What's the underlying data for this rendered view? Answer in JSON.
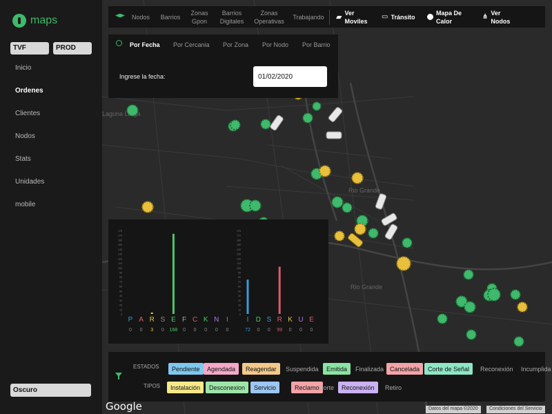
{
  "app": {
    "name": "maps"
  },
  "env": {
    "tvf": "TVF",
    "prod": "PROD"
  },
  "menu": [
    "Inicio",
    "Ordenes",
    "Clientes",
    "Nodos",
    "Stats",
    "Unidades",
    "mobile"
  ],
  "theme_button": "Oscuro",
  "toolbar": {
    "layers": [
      "Nodos",
      "Barrios",
      "Zonas Gpon",
      "Barrios Digitales",
      "Zonas Operativas",
      "Trabajando"
    ],
    "actions": [
      "Ver Moviles",
      "Tránsito",
      "Mapa De Calor",
      "Ver Nodos"
    ]
  },
  "search": {
    "tabs": [
      "Por Fecha",
      "Por Cercania",
      "Por Zona",
      "Por Nodo",
      "Por Barrio"
    ],
    "date_label": "Ingrese la fecha:",
    "date_value": "01/02/2020"
  },
  "map": {
    "labels": [
      "Laguna Larga",
      "Rio Grande",
      "Rio Grande"
    ],
    "google": "Google",
    "attrib_data": "Datos del mapa ©2020",
    "attrib_terms": "Condiciones del Servicio"
  },
  "chart_data": [
    {
      "type": "bar",
      "categories": [
        "P",
        "A",
        "R",
        "S",
        "E",
        "F",
        "C",
        "K",
        "N",
        "I"
      ],
      "values": [
        0,
        0,
        3,
        0,
        168,
        0,
        0,
        0,
        0,
        0
      ],
      "value_labels": [
        "0",
        "0",
        "3",
        "0",
        "168",
        "0",
        "0",
        "0",
        "0",
        "0"
      ],
      "colors": [
        "#3a9bd9",
        "#e05a6b",
        "#e0c04a",
        "#8a8a8a",
        "#4cc86b",
        "#aaaaaa",
        "#e05a6b",
        "#4cc86b",
        "#b07ae0",
        "#888888"
      ],
      "ylim": [
        0,
        175
      ],
      "yticks": [
        "175",
        "170",
        "160",
        "150",
        "140",
        "130",
        "120",
        "110",
        "100",
        "90",
        "80",
        "70",
        "60",
        "50",
        "40",
        "30",
        "20",
        "10",
        "0"
      ]
    },
    {
      "type": "bar",
      "categories": [
        "I",
        "D",
        "S",
        "R",
        "K",
        "U",
        "E"
      ],
      "values": [
        72,
        0,
        0,
        99,
        0,
        0,
        0
      ],
      "value_labels": [
        "72",
        "0",
        "0",
        "99",
        "0",
        "0",
        "0"
      ],
      "colors": [
        "#3a9bd9",
        "#4cc86b",
        "#3a9bd9",
        "#e05a6b",
        "#e0c04a",
        "#b07ae0",
        "#e05a6b"
      ],
      "ylim": [
        0,
        175
      ],
      "yticks": [
        "175",
        "170",
        "160",
        "150",
        "140",
        "130",
        "120",
        "110",
        "100",
        "90",
        "80",
        "70",
        "60",
        "50",
        "40",
        "30",
        "20",
        "10",
        "0"
      ]
    }
  ],
  "legend": {
    "estados_label": "ESTADOS",
    "tipos_label": "TIPOS",
    "estados": [
      {
        "label": "Pendiente",
        "color": "#7fc8ef"
      },
      {
        "label": "Agendada",
        "color": "#f4a9c7"
      },
      {
        "label": "Reagendar",
        "color": "#f3c98a"
      },
      {
        "label": "Suspendida",
        "color": ""
      },
      {
        "label": "Emitida",
        "color": "#8be3a3"
      },
      {
        "label": "Finalizada",
        "color": ""
      },
      {
        "label": "Cancelada",
        "color": "#f2a4a8"
      },
      {
        "label": "Corte de Señal",
        "color": "#8ee6c7"
      },
      {
        "label": "Reconexión",
        "color": ""
      },
      {
        "label": "Incumplida",
        "color": ""
      }
    ],
    "tipos": [
      {
        "label": "Instalación",
        "color": "#f6e98a"
      },
      {
        "label": "Desconexion",
        "color": "#9ee6a8"
      },
      {
        "label": "Servicio",
        "color": "#9dc6f2"
      },
      {
        "label": "Reclamo",
        "color": "#f2a4a8"
      },
      {
        "label": "Corte",
        "color": ""
      },
      {
        "label": "Reconexión",
        "color": "#cbb2f2"
      },
      {
        "label": "Retiro",
        "color": ""
      }
    ]
  }
}
